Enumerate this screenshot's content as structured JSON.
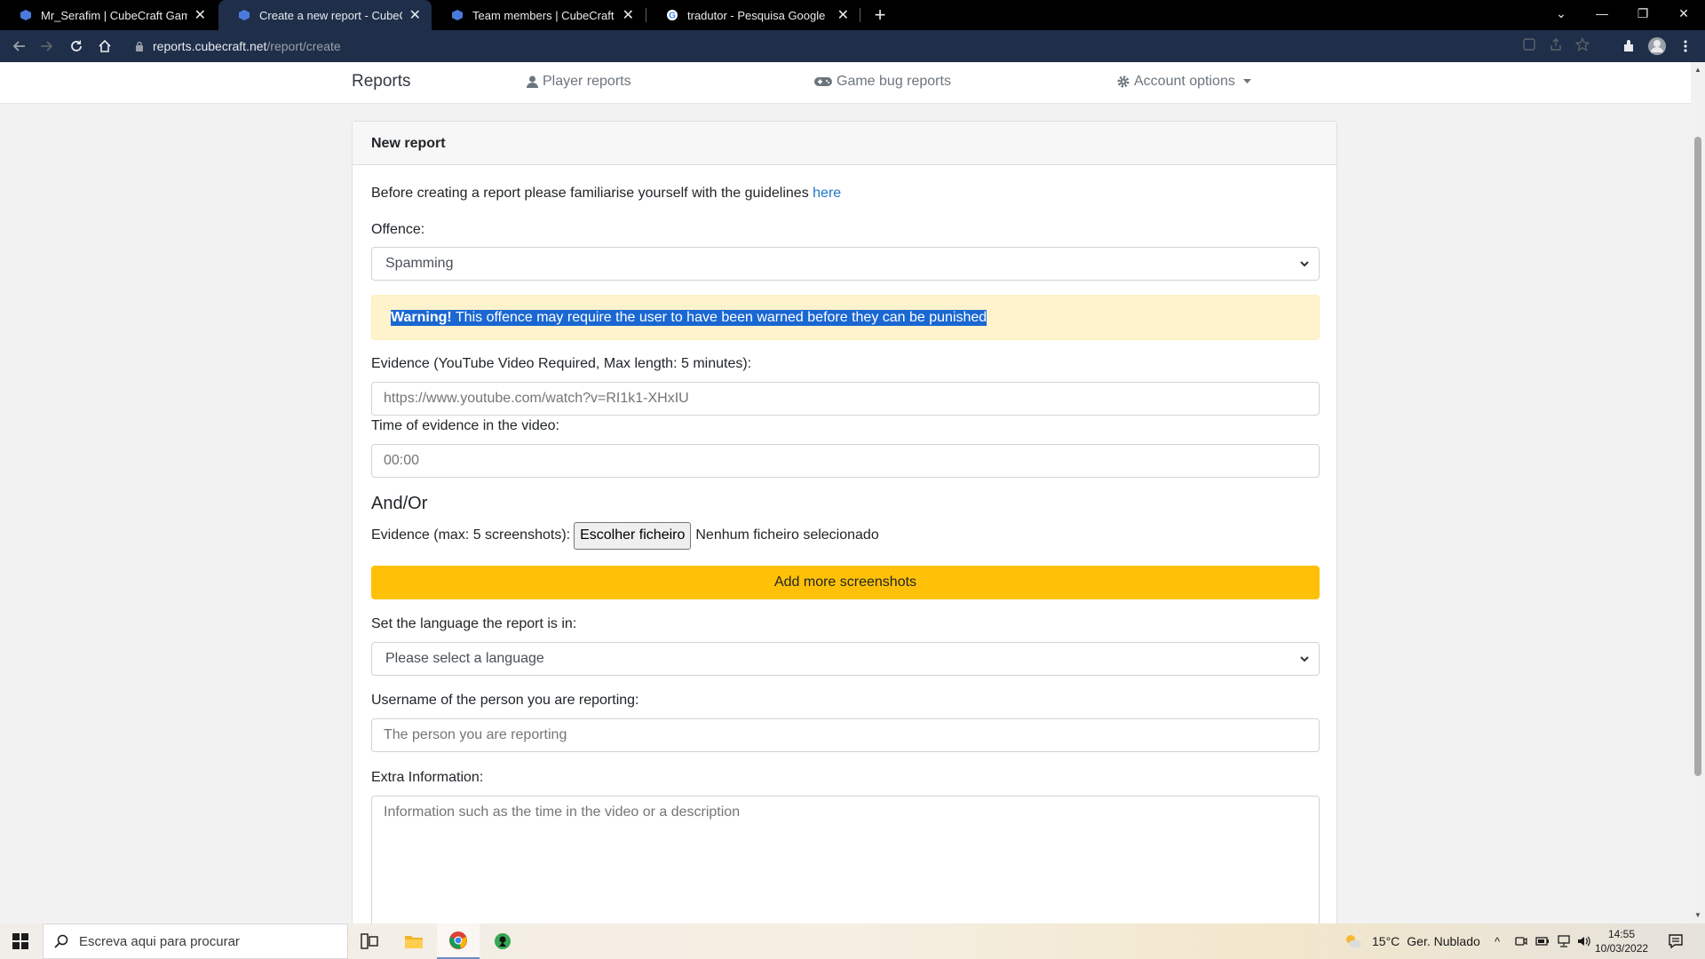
{
  "browser": {
    "tabs": [
      {
        "title": "Mr_Serafim | CubeCraft Games",
        "active": false
      },
      {
        "title": "Create a new report - CubeCraft",
        "active": true
      },
      {
        "title": "Team members | CubeCraft Gam",
        "active": false
      },
      {
        "title": "tradutor - Pesquisa Google",
        "active": false
      }
    ],
    "new_tab": "+",
    "url_host": "reports.cubecraft.net",
    "url_path": "/report/create"
  },
  "site_nav": {
    "brand": "Reports",
    "player_reports": "Player reports",
    "game_bug_reports": "Game bug reports",
    "account_options": "Account options"
  },
  "form": {
    "header": "New report",
    "intro_text": "Before creating a report please familiarise yourself with the guidelines",
    "intro_link": "here",
    "offence_label": "Offence:",
    "offence_value": "Spamming",
    "warning_strong": "Warning!",
    "warning_text": " This offence may require the user to have been warned before they can be punished",
    "evidence_video_label": "Evidence (YouTube Video Required, Max length: 5 minutes):",
    "evidence_video_placeholder": "https://www.youtube.com/watch?v=RI1k1-XHxIU",
    "time_label": "Time of evidence in the video:",
    "time_placeholder": "00:00",
    "and_or": "And/Or",
    "screenshots_label": "Evidence (max: 5 screenshots):",
    "file_button": "Escolher ficheiro",
    "file_status": "Nenhum ficheiro selecionado",
    "add_screenshots_button": "Add more screenshots",
    "language_label": "Set the language the report is in:",
    "language_value": "Please select a language",
    "username_label": "Username of the person you are reporting:",
    "username_placeholder": "The person you are reporting",
    "extra_label": "Extra Information:",
    "extra_placeholder": "Information such as the time in the video or a description"
  },
  "taskbar": {
    "search_placeholder": "Escreva aqui para procurar",
    "weather_temp": "15°C",
    "weather_text": "Ger. Nublado",
    "time": "14:55",
    "date": "10/03/2022"
  },
  "colors": {
    "link": "#1e76c8",
    "warning_bg": "#fff3cd",
    "warning_text": "#856404",
    "selection": "#1a67d2",
    "button_warning": "#ffc107"
  }
}
